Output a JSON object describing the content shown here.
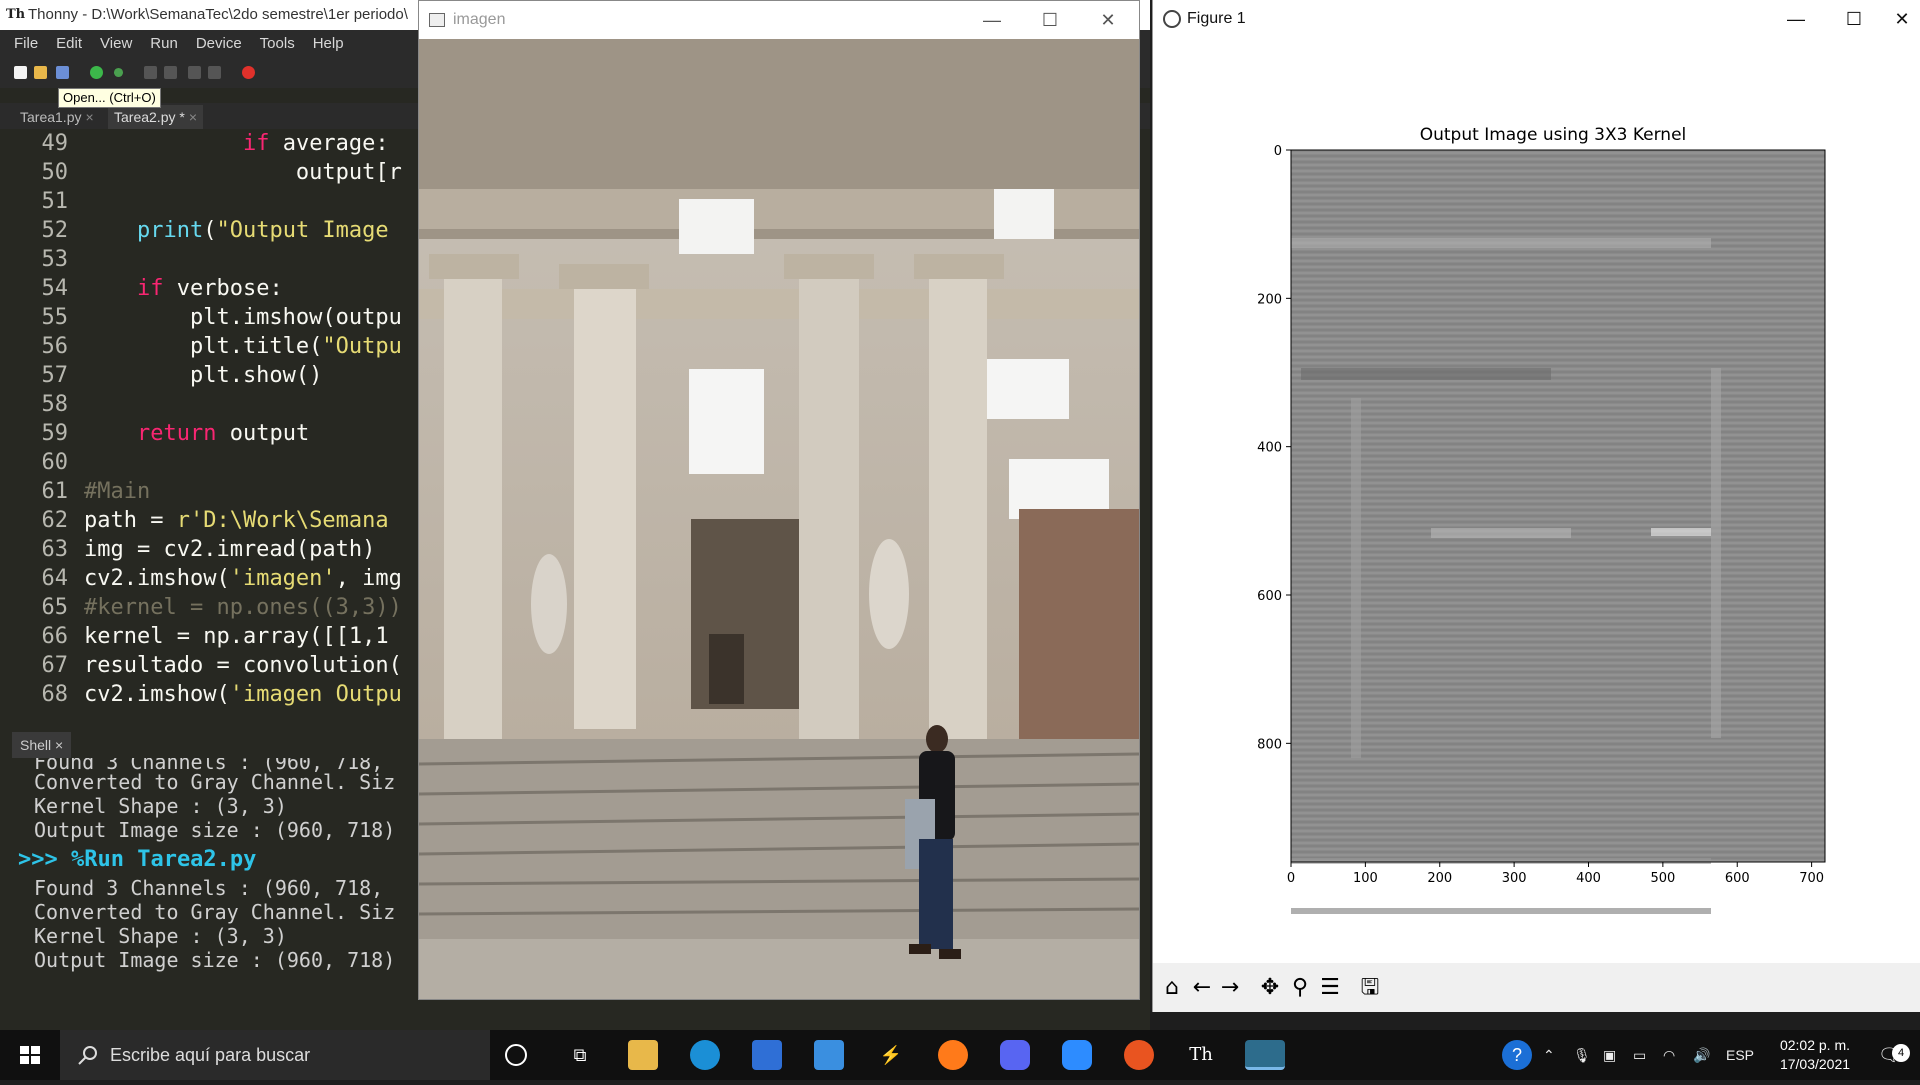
{
  "thonny": {
    "title": "Thonny  -  D:\\Work\\SemanaTec\\2do semestre\\1er periodo\\",
    "menu": [
      "File",
      "Edit",
      "View",
      "Run",
      "Device",
      "Tools",
      "Help"
    ],
    "tooltip": "Open... (Ctrl+O)",
    "tabs": [
      {
        "label": "Tarea1.py",
        "close": "×"
      },
      {
        "label": "Tarea2.py *",
        "close": "×"
      }
    ],
    "editor_lines": [
      {
        "n": "49",
        "t": "            if average:"
      },
      {
        "n": "50",
        "t": "                output[r"
      },
      {
        "n": "51",
        "t": ""
      },
      {
        "n": "52",
        "t": "    print(\"Output Image"
      },
      {
        "n": "53",
        "t": ""
      },
      {
        "n": "54",
        "t": "    if verbose:"
      },
      {
        "n": "55",
        "t": "        plt.imshow(outpu"
      },
      {
        "n": "56",
        "t": "        plt.title(\"Outpu"
      },
      {
        "n": "57",
        "t": "        plt.show()"
      },
      {
        "n": "58",
        "t": ""
      },
      {
        "n": "59",
        "t": "    return output"
      },
      {
        "n": "60",
        "t": ""
      },
      {
        "n": "61",
        "t": "#Main"
      },
      {
        "n": "62",
        "t": "path = r'D:\\Work\\Semana"
      },
      {
        "n": "63",
        "t": "img = cv2.imread(path)"
      },
      {
        "n": "64",
        "t": "cv2.imshow('imagen', img"
      },
      {
        "n": "65",
        "t": "#kernel = np.ones((3,3))"
      },
      {
        "n": "66",
        "t": "kernel = np.array([[1,1"
      },
      {
        "n": "67",
        "t": "resultado = convolution("
      },
      {
        "n": "68",
        "t": "cv2.imshow('imagen Outpu"
      }
    ],
    "shell_tab": "Shell ×",
    "shell_lines": [
      "Found 3 Channels : (960, 718,",
      "Converted to Gray Channel. Siz",
      "Kernel Shape : (3, 3)",
      "Output Image size : (960, 718)",
      ">>> %Run Tarea2.py",
      "Found 3 Channels : (960, 718,",
      "Converted to Gray Channel. Siz",
      "Kernel Shape : (3, 3)",
      "Output Image size : (960, 718)"
    ]
  },
  "imagen_window": {
    "title": "imagen",
    "minimize": "—",
    "maximize": "☐",
    "close": "✕"
  },
  "figure_window": {
    "title": "Figure 1",
    "minimize": "—",
    "maximize": "☐",
    "close": "✕",
    "toolbar": [
      "home-icon",
      "back-icon",
      "forward-icon",
      "pan-icon",
      "zoom-icon",
      "configure-icon",
      "save-icon"
    ]
  },
  "chart_data": {
    "type": "heatmap",
    "title": "Output Image using 3X3 Kernel",
    "xlabel": "",
    "ylabel": "",
    "x_ticks": [
      "0",
      "100",
      "200",
      "300",
      "400",
      "500",
      "600",
      "700"
    ],
    "y_ticks": [
      "0",
      "200",
      "400",
      "600",
      "800"
    ],
    "xlim": [
      0,
      718
    ],
    "ylim": [
      960,
      0
    ],
    "image_size": [
      960,
      718
    ],
    "colormap": "gray",
    "grid": false
  },
  "taskbar": {
    "search_placeholder": "Escribe aquí para buscar",
    "language": "ESP",
    "time": "02:02 p. m.",
    "date": "17/03/2021",
    "notification_count": "4"
  },
  "colors": {
    "editor_bg": "#272822",
    "keyword": "#f92672",
    "string": "#e6db74",
    "comment": "#75715e",
    "taskbar": "#101010"
  }
}
